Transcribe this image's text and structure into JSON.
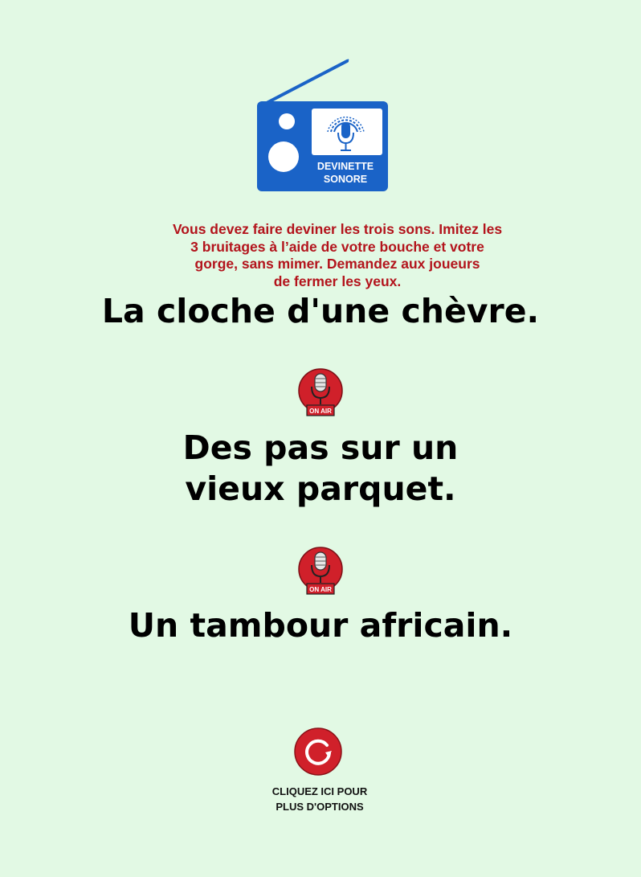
{
  "logo": {
    "line1": "DEVINETTE",
    "line2": "SONORE",
    "icon": "radio-microphone-icon",
    "color": "#1a63c7"
  },
  "instructions": "Vous devez faire deviner les trois sons. Imitez les\n3 bruitages à l’aide de votre bouche et votre\ngorge, sans mimer. Demandez aux joueurs\nde fermer les yeux.",
  "sounds": [
    "La cloche d'une chèvre.",
    "Des pas sur un\nvieux parquet.",
    "Un tambour africain."
  ],
  "on_air_badge": {
    "label": "ON AIR",
    "icon": "on-air-microphone-icon",
    "color": "#d0202a"
  },
  "options": {
    "icon": "refresh-icon",
    "label": "CLIQUEZ ICI POUR\nPLUS D'OPTIONS",
    "color": "#d0202a"
  },
  "colors": {
    "background": "#e2f9e4",
    "instructions_text": "#b3141c",
    "brand_blue": "#1a63c7",
    "accent_red": "#d0202a"
  }
}
